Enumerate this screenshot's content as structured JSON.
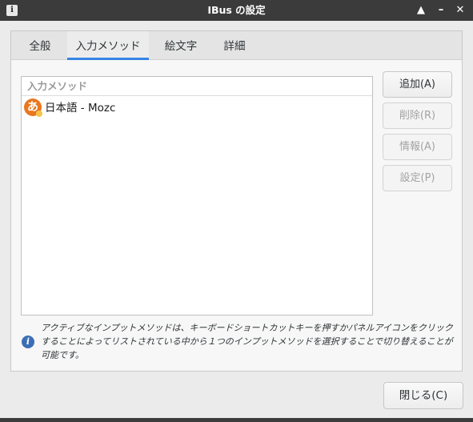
{
  "window": {
    "title": "IBus の設定",
    "info_icon_glyph": "i",
    "controls": {
      "up": "▲",
      "minimize": "–",
      "close": "✕"
    }
  },
  "tabs": [
    {
      "label": "全般",
      "active": false
    },
    {
      "label": "入力メソッド",
      "active": true
    },
    {
      "label": "絵文字",
      "active": false
    },
    {
      "label": "詳細",
      "active": false
    }
  ],
  "input_methods": {
    "header": "入力メソッド",
    "items": [
      {
        "icon_glyph": "あ",
        "label": "日本語 - Mozc"
      }
    ]
  },
  "buttons": {
    "add": "追加(A)",
    "remove": "削除(R)",
    "info": "情報(A)",
    "settings": "設定(P)",
    "close": "閉じる(C)"
  },
  "info": {
    "icon_glyph": "i",
    "text": "アクティブなインプットメソッドは、キーボードショートカットキーを押すかパネルアイコンをクリックすることによってリストされている中から１つのインプットメソッドを選択することで切り替えることが可能です。"
  },
  "colors": {
    "accent": "#3584e4",
    "titlebar": "#3b3b3b",
    "engine_icon": "#e8771f",
    "info_icon": "#3d6eb5"
  }
}
